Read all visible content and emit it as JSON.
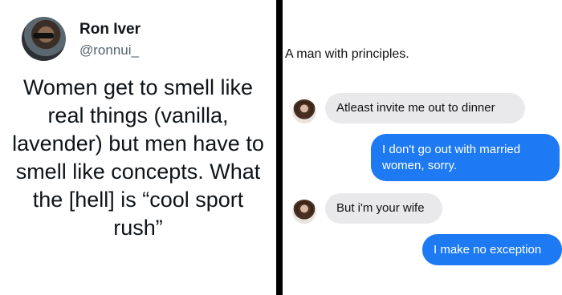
{
  "tweet": {
    "user_name": "Ron Iver",
    "user_handle": "@ronnui_",
    "text": "Women get to smell like real things (vanilla, lavender) but men have to smell like concepts. What the [hell] is “cool sport rush”"
  },
  "chat": {
    "caption": "A man with principles.",
    "messages": [
      {
        "side": "received",
        "text": "Atleast invite me out to dinner"
      },
      {
        "side": "sent",
        "text": "I don't go out with married women, sorry."
      },
      {
        "side": "received",
        "text": "But i'm your wife"
      },
      {
        "side": "sent",
        "text": "I make no exception"
      }
    ]
  },
  "colors": {
    "sent_bubble": "#1d7af3",
    "received_bubble": "#e9e9eb",
    "divider": "#000000",
    "handle_gray": "#536471"
  },
  "icons": [
    "tweet-avatar-photo",
    "chat-avatar-photo"
  ]
}
